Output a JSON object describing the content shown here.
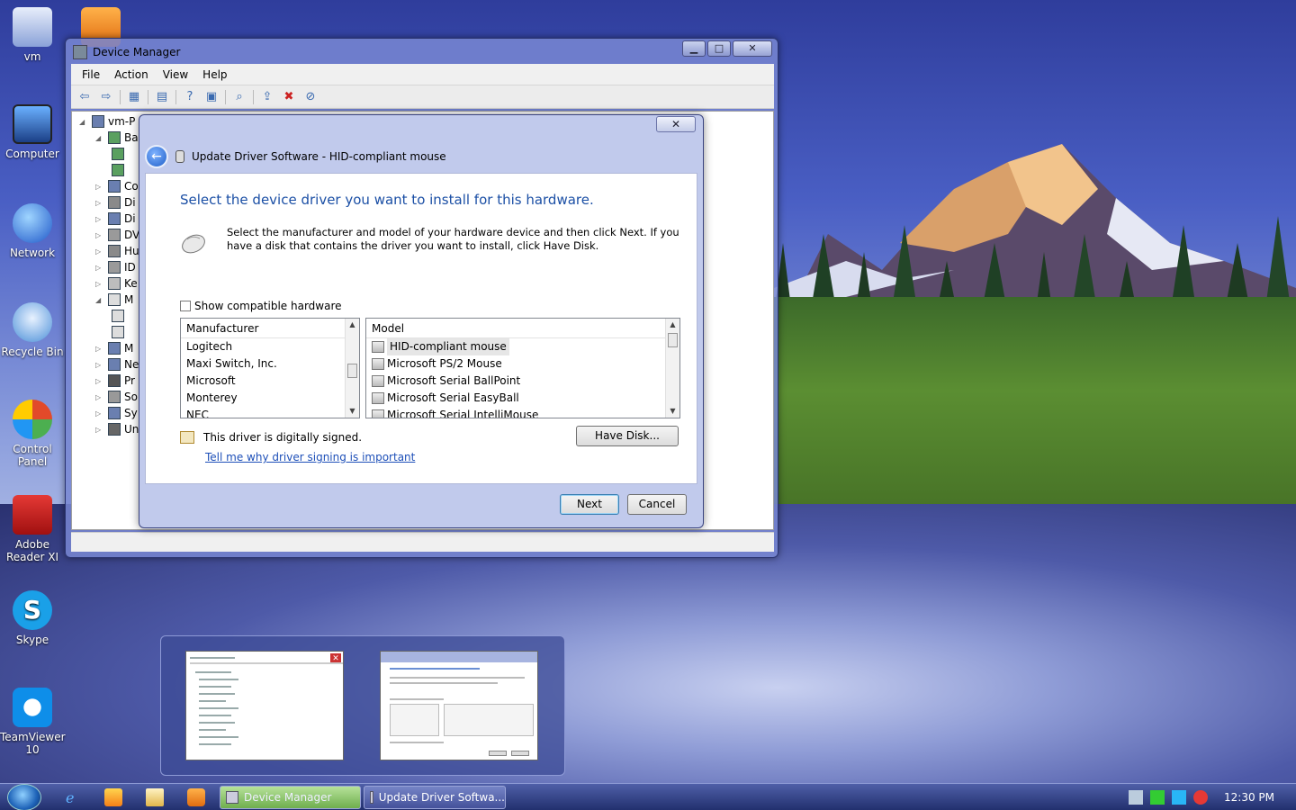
{
  "desktop": {
    "icons": [
      {
        "label": "vm"
      },
      {
        "label": "Computer"
      },
      {
        "label": "Network"
      },
      {
        "label": "Recycle Bin"
      },
      {
        "label": "Control Panel"
      },
      {
        "label": "Adobe Reader XI"
      },
      {
        "label": "Skype"
      },
      {
        "label": "TeamViewer 10"
      }
    ]
  },
  "device_manager": {
    "title": "Device Manager",
    "menu": [
      "File",
      "Action",
      "View",
      "Help"
    ],
    "tree": [
      {
        "label": "vm-P"
      },
      {
        "label": "Ba"
      },
      {
        "label": "Co"
      },
      {
        "label": "Di"
      },
      {
        "label": "Di"
      },
      {
        "label": "DV"
      },
      {
        "label": "Hu"
      },
      {
        "label": "ID"
      },
      {
        "label": "Ke"
      },
      {
        "label": "M"
      },
      {
        "label": "M"
      },
      {
        "label": "Ne"
      },
      {
        "label": "Pr"
      },
      {
        "label": "So"
      },
      {
        "label": "Sy"
      },
      {
        "label": "Un"
      }
    ]
  },
  "update_driver": {
    "title": "Update Driver Software - HID-compliant mouse",
    "heading": "Select the device driver you want to install for this hardware.",
    "description": "Select the manufacturer and model of your hardware device and then click Next. If you have a disk that contains the driver you want to install, click Have Disk.",
    "show_compatible_label": "Show compatible hardware",
    "manufacturer_header": "Manufacturer",
    "manufacturers": [
      "Logitech",
      "Maxi Switch, Inc.",
      "Microsoft",
      "Monterey",
      "NEC"
    ],
    "model_header": "Model",
    "models": [
      "HID-compliant mouse",
      "Microsoft PS/2 Mouse",
      "Microsoft Serial BallPoint",
      "Microsoft Serial EasyBall",
      "Microsoft Serial IntelliMouse"
    ],
    "signed_text": "This driver is digitally signed.",
    "signing_link": "Tell me why driver signing is important",
    "have_disk_label": "Have Disk...",
    "next_label": "Next",
    "cancel_label": "Cancel"
  },
  "taskbar": {
    "buttons": [
      {
        "label": "Device Manager"
      },
      {
        "label": "Update Driver Softwa..."
      }
    ],
    "clock": "12:30 PM"
  }
}
